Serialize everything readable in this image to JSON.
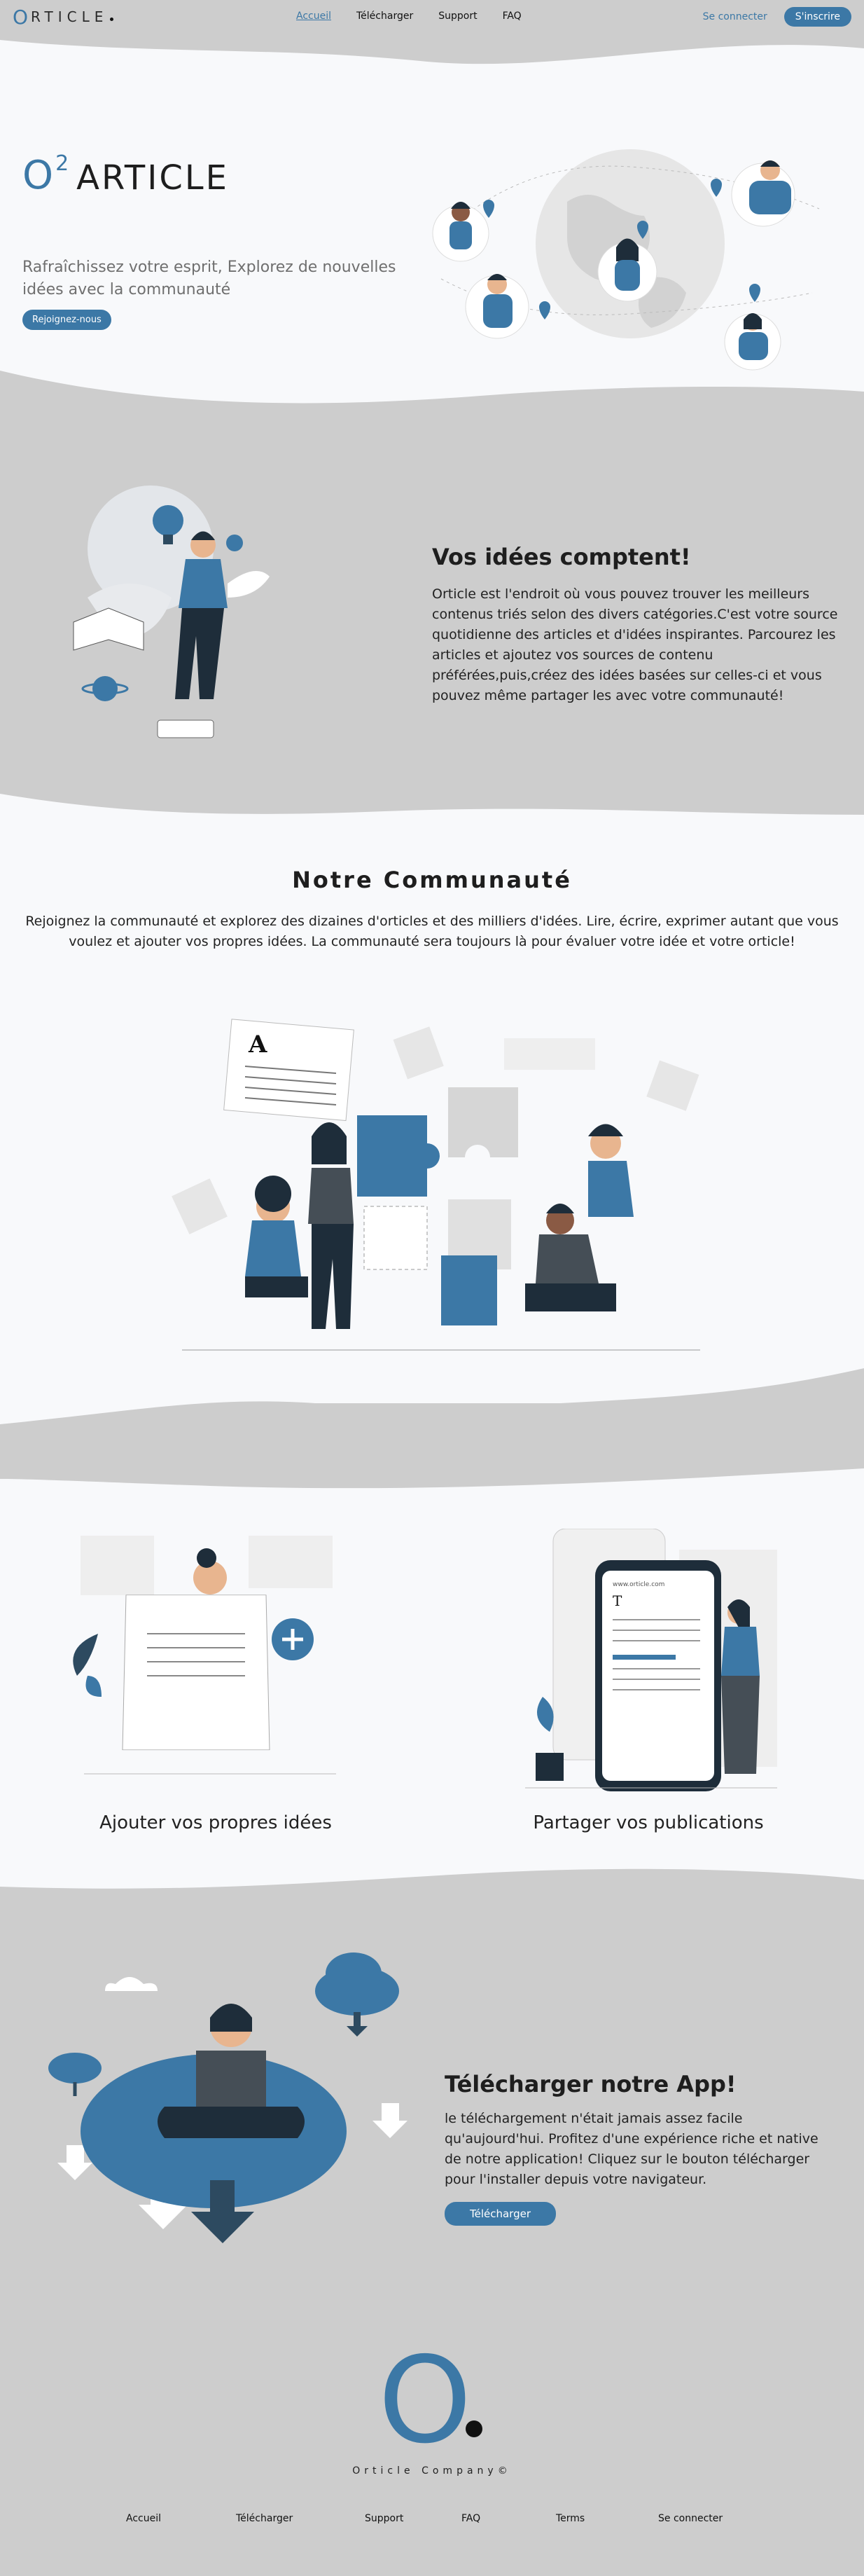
{
  "nav": {
    "logo_o": "O",
    "logo_text": "RTICLE",
    "links": [
      "Accueil",
      "Télécharger",
      "Support",
      "FAQ"
    ],
    "login": "Se connecter",
    "signup": "S'inscrire"
  },
  "hero": {
    "title_o": "O",
    "title_sup": "2",
    "title_rest": "ARTICLE",
    "tagline": "Rafraîchissez votre esprit, Explorez de nouvelles idées avec la communauté",
    "cta": "Rejoignez-nous"
  },
  "ideas": {
    "heading": "Vos idées comptent!",
    "text": "Orticle est l'endroit où vous pouvez trouver les meilleurs contenus triés selon des divers catégories.C'est votre source quotidienne des articles et d'idées inspirantes. Parcourez les articles et ajoutez vos sources de contenu préférées,puis,créez des idées basées sur celles-ci et vous pouvez même partager les avec votre communauté!"
  },
  "community": {
    "heading": "Notre Communauté",
    "text": "Rejoignez la communauté et explorez des dizaines d'orticles et des milliers d'idées. Lire, écrire, exprimer autant que vous voulez et ajouter vos propres idées. La communauté sera toujours là pour évaluer votre idée et votre orticle!"
  },
  "features": {
    "left_label": "Ajouter vos propres idées",
    "right_label": "Partager vos publications",
    "phone_url": "www.orticle.com",
    "phone_letter": "T"
  },
  "app": {
    "heading": "Télécharger notre App!",
    "text": "le téléchargement n'était jamais assez facile qu'aujourd'hui. Profitez d'une expérience riche et native de notre application! Cliquez sur le bouton télécharger pour l'installer depuis votre navigateur.",
    "button": "Télécharger"
  },
  "footer": {
    "big_o": "O",
    "company": "Orticle Company©",
    "links": [
      "Accueil",
      "Télécharger",
      "Support",
      "FAQ",
      "Terms",
      "Se connecter"
    ]
  },
  "colors": {
    "accent": "#3c78a6",
    "light_bg": "#f8f9fb",
    "gray_bg": "#cdcdcd"
  }
}
